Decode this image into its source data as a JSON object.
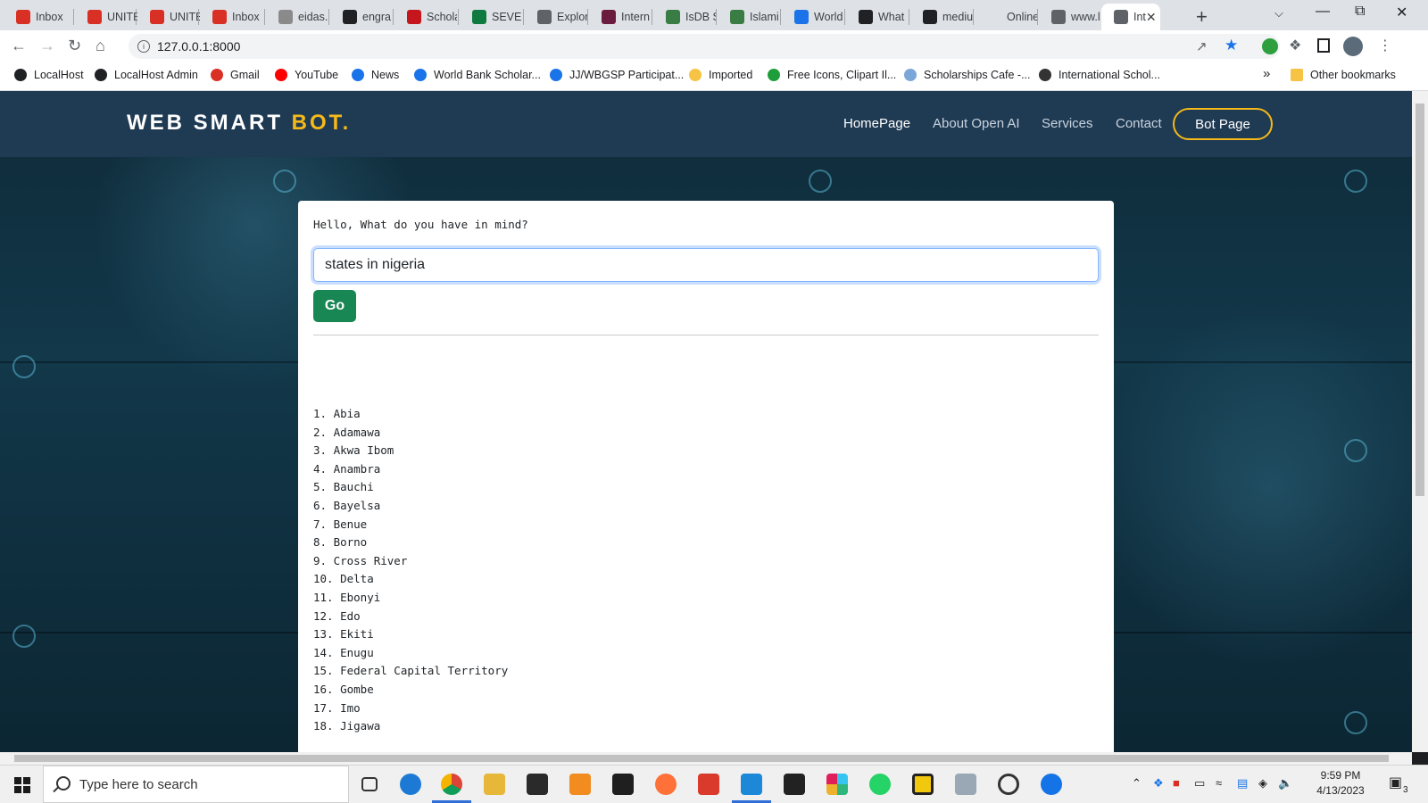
{
  "browser": {
    "tabs": [
      {
        "label": "Inbox",
        "icon": "gmail-icon",
        "color": "#d93025"
      },
      {
        "label": "UNITE",
        "icon": "red-circle-icon",
        "color": "#d93025"
      },
      {
        "label": "UNITE",
        "icon": "red-circle-icon",
        "color": "#d93025"
      },
      {
        "label": "Inbox",
        "icon": "gmail-icon",
        "color": "#d93025"
      },
      {
        "label": "eidas.",
        "icon": "document-icon",
        "color": "#8a8a8a"
      },
      {
        "label": "engra",
        "icon": "github-icon",
        "color": "#202124"
      },
      {
        "label": "Schola",
        "icon": "bars-icon",
        "color": "#c5161d"
      },
      {
        "label": "SEVE (",
        "icon": "green-square-icon",
        "color": "#0f7a3f"
      },
      {
        "label": "Explor",
        "icon": "globe-icon",
        "color": "#5f6368"
      },
      {
        "label": "Intern",
        "icon": "u-icon",
        "color": "#6b1b3e"
      },
      {
        "label": "IsDB S",
        "icon": "leaf-icon",
        "color": "#3a7d44"
      },
      {
        "label": "Islami",
        "icon": "leaf-icon",
        "color": "#3a7d44"
      },
      {
        "label": "World",
        "icon": "globe-icon",
        "color": "#1a73e8"
      },
      {
        "label": "What",
        "icon": "circle-icon",
        "color": "#202124"
      },
      {
        "label": "mediu",
        "icon": "medium-icon",
        "color": "#202124"
      },
      {
        "label": "Online",
        "icon": "blank-icon",
        "color": "#dee1e6"
      },
      {
        "label": "www.l",
        "icon": "linkedin-icon",
        "color": "#5f6368"
      },
      {
        "label": "Int",
        "icon": "globe-icon",
        "color": "#5f6368",
        "active": true
      }
    ],
    "new_tab": "+",
    "url": "127.0.0.1:8000",
    "bookmarks": [
      {
        "label": "LocalHost",
        "color": "#202124"
      },
      {
        "label": "LocalHost Admin",
        "color": "#202124"
      },
      {
        "label": "Gmail",
        "color": "#d93025"
      },
      {
        "label": "YouTube",
        "color": "#ff0000"
      },
      {
        "label": "News",
        "color": "#1a73e8"
      },
      {
        "label": "World Bank Scholar...",
        "color": "#1a73e8"
      },
      {
        "label": "JJ/WBGSP Participat...",
        "color": "#1a73e8"
      },
      {
        "label": "Imported",
        "color": "#f6c344"
      },
      {
        "label": "Free Icons, Clipart Il...",
        "color": "#1e9e3a"
      },
      {
        "label": "Scholarships Cafe -...",
        "color": "#7aa7d8"
      },
      {
        "label": "International Schol...",
        "color": "#333333"
      }
    ],
    "bookmarks_overflow": "»",
    "other_bookmarks": "Other bookmarks"
  },
  "site": {
    "brand_main": "WEB SMART ",
    "brand_accent": "BOT.",
    "nav": [
      "HomePage",
      "About Open AI",
      "Services",
      "Contact"
    ],
    "cta": "Bot Page",
    "accent_color": "#f5b91a"
  },
  "bot": {
    "prompt": "Hello, What do you have in mind?",
    "query": "states in nigeria",
    "submit": "Go",
    "results": [
      "1. Abia",
      "2. Adamawa",
      "3. Akwa Ibom",
      "4. Anambra",
      "5. Bauchi",
      "6. Bayelsa",
      "7. Benue",
      "8. Borno",
      "9. Cross River",
      "10. Delta",
      "11. Ebonyi",
      "12. Edo",
      "13. Ekiti",
      "14. Enugu",
      "15. Federal Capital Territory",
      "16. Gombe",
      "17. Imo",
      "18. Jigawa"
    ]
  },
  "taskbar": {
    "search_placeholder": "Type here to search",
    "time": "9:59 PM",
    "date": "4/13/2023",
    "notification_count": "3"
  }
}
